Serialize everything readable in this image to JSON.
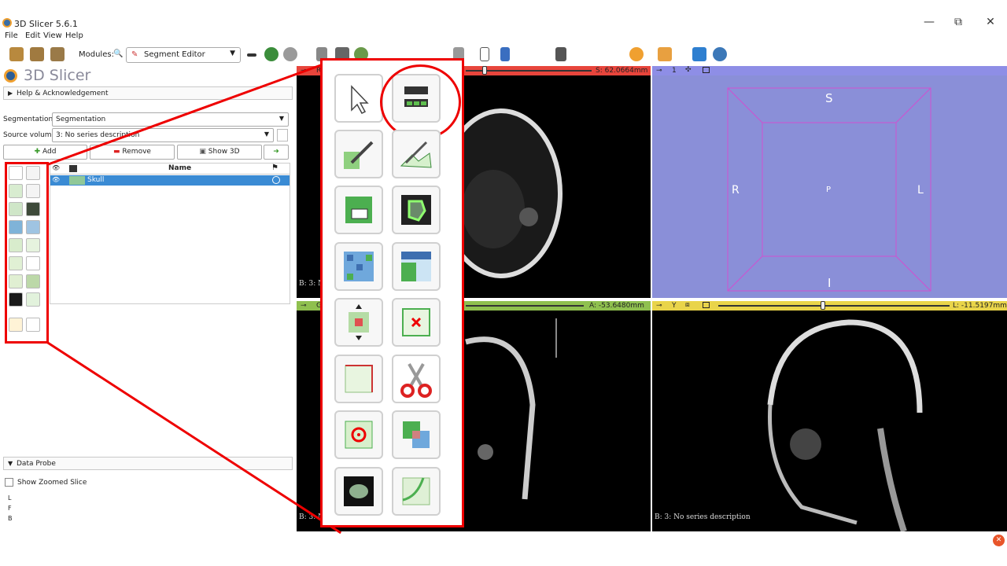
{
  "window": {
    "title": "3D Slicer 5.6.1",
    "minimize": "—",
    "restore": "⧉",
    "close": "✕"
  },
  "menubar": {
    "items": [
      "File",
      "Edit",
      "View",
      "Help"
    ]
  },
  "toolbar": {
    "modules_label": "Modules:",
    "module_value": "Segment Editor"
  },
  "app_logo_text": "3D Slicer",
  "help_section": "Help & Acknowledgement",
  "segmentation": {
    "label": "Segmentation:",
    "value": "Segmentation"
  },
  "source_volume": {
    "label": "Source volume:",
    "value": "3: No series description"
  },
  "actions": {
    "add": "Add",
    "remove": "Remove",
    "show3d": "Show 3D"
  },
  "table": {
    "name_header": "Name",
    "rows": [
      {
        "name": "Skull",
        "color": "#90c898"
      }
    ]
  },
  "data_probe": {
    "section": "Data Probe",
    "zoomed_label": "Show Zoomed Slice",
    "lines": [
      "L",
      "F",
      "B"
    ]
  },
  "viewers": {
    "red": {
      "label": "R",
      "value": "S: 62.0664mm",
      "corner": "B: 3: N"
    },
    "green": {
      "label": "G",
      "value": "A: -53.6480mm",
      "corner": "B: 3: N"
    },
    "yellow": {
      "label": "Y",
      "value": "L: -11.5197mm",
      "corner": "B: 3: No series description"
    },
    "threed": {
      "label": "1",
      "orient": {
        "top": "S",
        "left": "R",
        "center": "P",
        "right": "L",
        "bottom": "I"
      }
    }
  },
  "colors": {
    "red_bar": "#e8453c",
    "green_bar": "#8fc04f",
    "yellow_bar": "#e9d44a",
    "threed_bar": "#8e8ee6",
    "threed_bg": "#8a8fd8",
    "selection": "#3a8bd4",
    "callout": "#e00000",
    "box_lines": "#d050d0"
  }
}
